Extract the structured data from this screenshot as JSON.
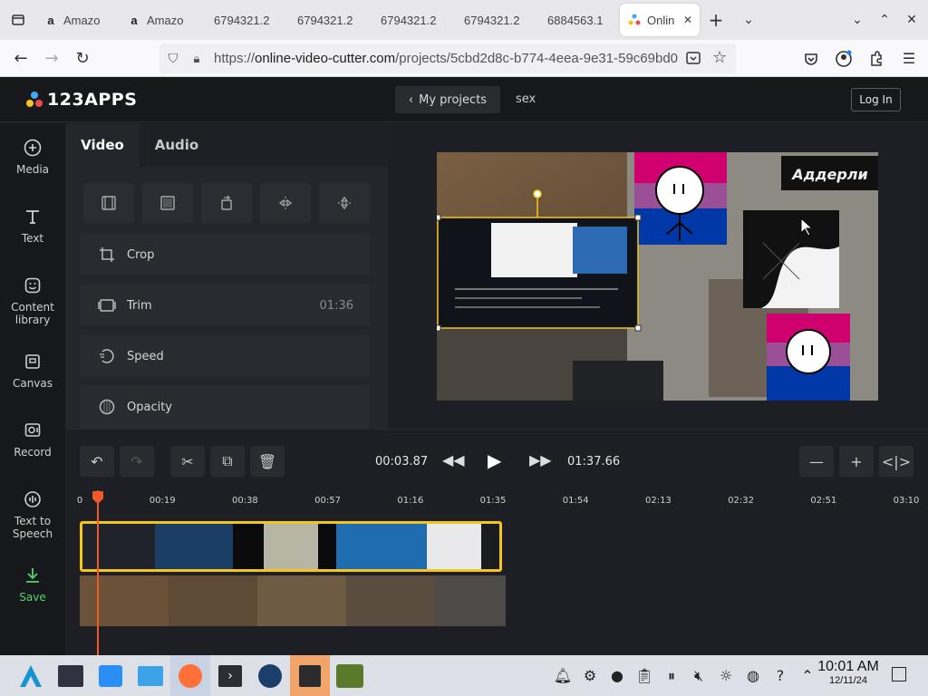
{
  "browser": {
    "tabs": [
      {
        "label": "Amazo",
        "favicon": "amazon-icon",
        "active": false
      },
      {
        "label": "Amazo",
        "favicon": "amazon-icon",
        "active": false
      },
      {
        "label": "6794321.2",
        "favicon": "",
        "active": false
      },
      {
        "label": "6794321.2",
        "favicon": "",
        "active": false
      },
      {
        "label": "6794321.2",
        "favicon": "",
        "active": false
      },
      {
        "label": "6794321.2",
        "favicon": "",
        "active": false
      },
      {
        "label": "6884563.1",
        "favicon": "",
        "active": false
      },
      {
        "label": "Onlin",
        "favicon": "123apps-icon",
        "active": true
      }
    ],
    "url_prefix": "https://",
    "url_host": "online-video-cutter.com",
    "url_path": "/projects/5cbd2d8c-b774-4eea-9e31-59c69bd0"
  },
  "app": {
    "logo": "123APPS",
    "my_projects": "My projects",
    "project_name": "sex",
    "login": "Log In",
    "sidebar": [
      {
        "label": "Media",
        "icon": "plus-circle-icon"
      },
      {
        "label": "Text",
        "icon": "text-icon"
      },
      {
        "label": "Content library",
        "icon": "sticker-icon"
      },
      {
        "label": "Canvas",
        "icon": "canvas-icon"
      },
      {
        "label": "Record",
        "icon": "record-icon"
      },
      {
        "label": "Text to Speech",
        "icon": "tts-icon"
      },
      {
        "label": "Save",
        "icon": "download-icon"
      }
    ],
    "panel_tabs": [
      "Video",
      "Audio"
    ],
    "panel_rows": [
      {
        "label": "Crop",
        "value": ""
      },
      {
        "label": "Trim",
        "value": "01:36"
      },
      {
        "label": "Speed",
        "value": ""
      },
      {
        "label": "Opacity",
        "value": ""
      }
    ],
    "preview_overlay_text": "Аддерли",
    "timeline": {
      "current_time": "00:03.87",
      "total_time": "01:37.66",
      "ticks": [
        "0",
        "00:19",
        "00:38",
        "00:57",
        "01:16",
        "01:35",
        "01:54",
        "02:13",
        "02:32",
        "02:51",
        "03:10"
      ]
    }
  },
  "taskbar": {
    "time": "10:01 AM",
    "date": "12/11/24"
  }
}
